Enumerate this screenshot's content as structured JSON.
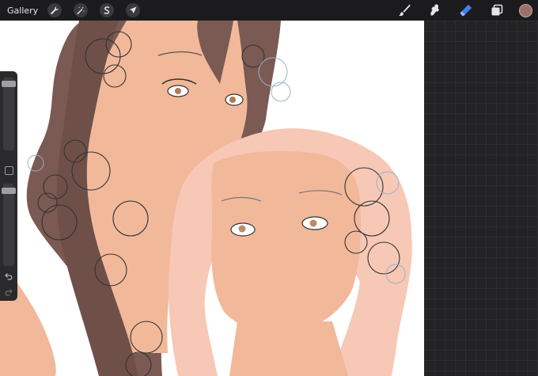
{
  "topbar": {
    "gallery_label": "Gallery",
    "left_tools": [
      {
        "name": "actions",
        "icon": "wrench-icon"
      },
      {
        "name": "adjustments",
        "icon": "magic-wand-icon"
      },
      {
        "name": "selection",
        "icon": "selection-s-icon"
      },
      {
        "name": "transform",
        "icon": "arrow-cursor-icon"
      }
    ],
    "right_tools": [
      {
        "name": "brush",
        "icon": "brush-icon",
        "active": false
      },
      {
        "name": "smudge",
        "icon": "smudge-icon",
        "active": false
      },
      {
        "name": "eraser",
        "icon": "eraser-icon",
        "active": true
      },
      {
        "name": "layers",
        "icon": "layers-icon",
        "active": false
      }
    ],
    "current_color": "#9a7068"
  },
  "sidebar": {
    "brush_size_level": 0.95,
    "opacity_level": 0.95
  },
  "colors": {
    "accent": "#2f6ee6",
    "hair_dark": "#7a5a52",
    "skin": "#f2b89a",
    "hair_light": "#f7c8b6"
  }
}
